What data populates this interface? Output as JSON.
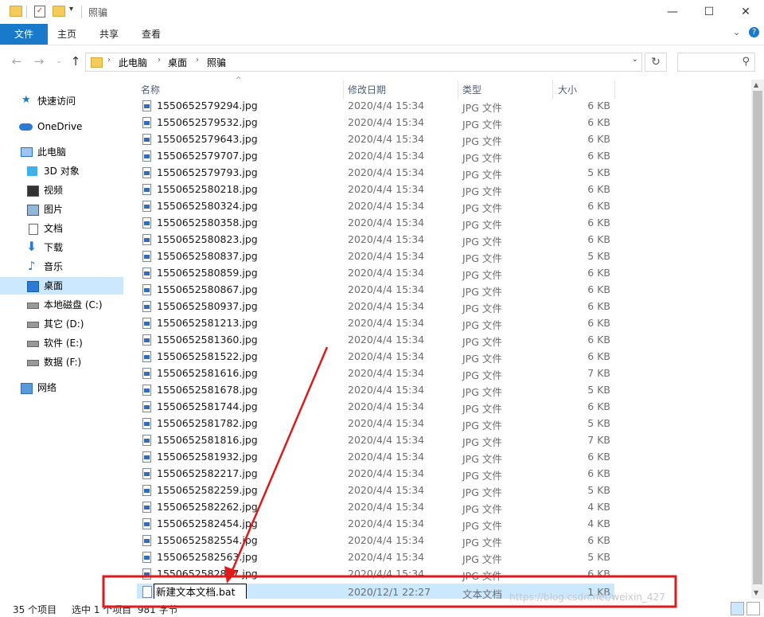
{
  "window": {
    "title": "照骗",
    "controls": {
      "minimize": "—",
      "maximize": "☐",
      "close": "✕"
    }
  },
  "ribbon": {
    "file_tab": "文件",
    "tabs": [
      "主页",
      "共享",
      "查看"
    ],
    "help": "?"
  },
  "address": {
    "crumbs": [
      "此电脑",
      "桌面",
      "照骗"
    ],
    "separator": "›",
    "search_placeholder": ""
  },
  "sidebar": {
    "items": [
      {
        "label": "快速访问",
        "icon": "star-icon"
      },
      {
        "label": "OneDrive",
        "icon": "cloud-icon"
      },
      {
        "label": "此电脑",
        "icon": "pc-icon"
      },
      {
        "label": "3D 对象",
        "icon": "cube-icon"
      },
      {
        "label": "视频",
        "icon": "video-icon"
      },
      {
        "label": "图片",
        "icon": "picture-icon"
      },
      {
        "label": "文档",
        "icon": "document-icon"
      },
      {
        "label": "下载",
        "icon": "download-icon"
      },
      {
        "label": "音乐",
        "icon": "music-icon"
      },
      {
        "label": "桌面",
        "icon": "desktop-icon"
      },
      {
        "label": "本地磁盘 (C:)",
        "icon": "drive-icon"
      },
      {
        "label": "其它 (D:)",
        "icon": "drive-icon"
      },
      {
        "label": "软件 (E:)",
        "icon": "drive-icon"
      },
      {
        "label": "数据 (F:)",
        "icon": "drive-icon"
      },
      {
        "label": "网络",
        "icon": "network-icon"
      }
    ],
    "selected_index": 9
  },
  "columns": {
    "name": "名称",
    "date": "修改日期",
    "type": "类型",
    "size": "大小"
  },
  "files": [
    {
      "name": "1550652579294.jpg",
      "date": "2020/4/4 15:34",
      "type": "JPG 文件",
      "size": "6 KB"
    },
    {
      "name": "1550652579532.jpg",
      "date": "2020/4/4 15:34",
      "type": "JPG 文件",
      "size": "6 KB"
    },
    {
      "name": "1550652579643.jpg",
      "date": "2020/4/4 15:34",
      "type": "JPG 文件",
      "size": "6 KB"
    },
    {
      "name": "1550652579707.jpg",
      "date": "2020/4/4 15:34",
      "type": "JPG 文件",
      "size": "6 KB"
    },
    {
      "name": "1550652579793.jpg",
      "date": "2020/4/4 15:34",
      "type": "JPG 文件",
      "size": "5 KB"
    },
    {
      "name": "1550652580218.jpg",
      "date": "2020/4/4 15:34",
      "type": "JPG 文件",
      "size": "6 KB"
    },
    {
      "name": "1550652580324.jpg",
      "date": "2020/4/4 15:34",
      "type": "JPG 文件",
      "size": "6 KB"
    },
    {
      "name": "1550652580358.jpg",
      "date": "2020/4/4 15:34",
      "type": "JPG 文件",
      "size": "6 KB"
    },
    {
      "name": "1550652580823.jpg",
      "date": "2020/4/4 15:34",
      "type": "JPG 文件",
      "size": "6 KB"
    },
    {
      "name": "1550652580837.jpg",
      "date": "2020/4/4 15:34",
      "type": "JPG 文件",
      "size": "5 KB"
    },
    {
      "name": "1550652580859.jpg",
      "date": "2020/4/4 15:34",
      "type": "JPG 文件",
      "size": "6 KB"
    },
    {
      "name": "1550652580867.jpg",
      "date": "2020/4/4 15:34",
      "type": "JPG 文件",
      "size": "6 KB"
    },
    {
      "name": "1550652580937.jpg",
      "date": "2020/4/4 15:34",
      "type": "JPG 文件",
      "size": "6 KB"
    },
    {
      "name": "1550652581213.jpg",
      "date": "2020/4/4 15:34",
      "type": "JPG 文件",
      "size": "6 KB"
    },
    {
      "name": "1550652581360.jpg",
      "date": "2020/4/4 15:34",
      "type": "JPG 文件",
      "size": "6 KB"
    },
    {
      "name": "1550652581522.jpg",
      "date": "2020/4/4 15:34",
      "type": "JPG 文件",
      "size": "6 KB"
    },
    {
      "name": "1550652581616.jpg",
      "date": "2020/4/4 15:34",
      "type": "JPG 文件",
      "size": "7 KB"
    },
    {
      "name": "1550652581678.jpg",
      "date": "2020/4/4 15:34",
      "type": "JPG 文件",
      "size": "5 KB"
    },
    {
      "name": "1550652581744.jpg",
      "date": "2020/4/4 15:34",
      "type": "JPG 文件",
      "size": "6 KB"
    },
    {
      "name": "1550652581782.jpg",
      "date": "2020/4/4 15:34",
      "type": "JPG 文件",
      "size": "5 KB"
    },
    {
      "name": "1550652581816.jpg",
      "date": "2020/4/4 15:34",
      "type": "JPG 文件",
      "size": "7 KB"
    },
    {
      "name": "1550652581932.jpg",
      "date": "2020/4/4 15:34",
      "type": "JPG 文件",
      "size": "6 KB"
    },
    {
      "name": "1550652582217.jpg",
      "date": "2020/4/4 15:34",
      "type": "JPG 文件",
      "size": "6 KB"
    },
    {
      "name": "1550652582259.jpg",
      "date": "2020/4/4 15:34",
      "type": "JPG 文件",
      "size": "5 KB"
    },
    {
      "name": "1550652582262.jpg",
      "date": "2020/4/4 15:34",
      "type": "JPG 文件",
      "size": "4 KB"
    },
    {
      "name": "1550652582454.jpg",
      "date": "2020/4/4 15:34",
      "type": "JPG 文件",
      "size": "4 KB"
    },
    {
      "name": "1550652582554.jpg",
      "date": "2020/4/4 15:34",
      "type": "JPG 文件",
      "size": "6 KB"
    },
    {
      "name": "1550652582563.jpg",
      "date": "2020/4/4 15:34",
      "type": "JPG 文件",
      "size": "5 KB"
    },
    {
      "name": "1550652582887.jpg",
      "date": "2020/4/4 15:34",
      "type": "JPG 文件",
      "size": "6 KB"
    }
  ],
  "renaming_file": {
    "name": "新建文本文档.bat",
    "date": "2020/12/1 22:27",
    "type": "文本文档",
    "size": "1 KB"
  },
  "status": {
    "item_count": "35 个项目",
    "selection": "选中 1 个项目  981 字节"
  },
  "watermark": "https://blog.csdn.net/weixin_427",
  "colors": {
    "accent": "#1979ca",
    "selection": "#cce8ff",
    "annotation": "#e0191b"
  }
}
